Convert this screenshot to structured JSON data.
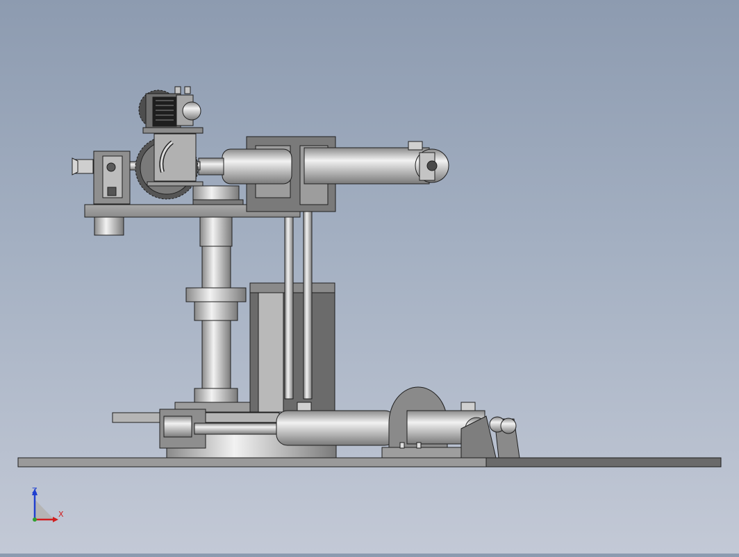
{
  "viewport": {
    "background_top": "#8d9bb0",
    "background_bottom": "#c3c9d6"
  },
  "model": {
    "metal_light": "#e2e2e2",
    "metal_mid": "#a6a6a6",
    "metal_dark": "#5e5e5e",
    "edge": "#1e1e1e"
  },
  "triad": {
    "z_label": "Z",
    "x_label": "X",
    "z_color": "#1f3fd0",
    "x_color": "#d01f1f"
  }
}
